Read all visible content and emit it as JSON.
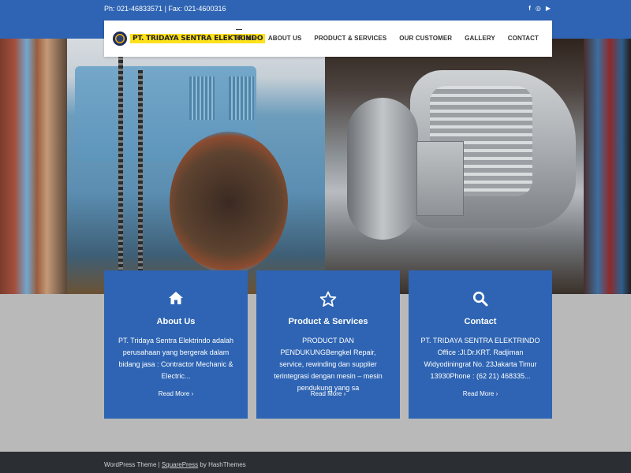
{
  "topbar": {
    "contact_text": "Ph: 021-46833571 | Fax: 021-4600316",
    "social": [
      {
        "icon": "facebook-icon",
        "glyph": "f"
      },
      {
        "icon": "instagram-icon",
        "glyph": "◎"
      },
      {
        "icon": "youtube-icon",
        "glyph": "▶"
      }
    ]
  },
  "brand": {
    "logo_text": "PT. TRIDAYA SENTRA ELEKTRINDO"
  },
  "nav": {
    "items": [
      {
        "label": "HOME",
        "active": true
      },
      {
        "label": "ABOUT US"
      },
      {
        "label": "PRODUCT & SERVICES"
      },
      {
        "label": "OUR CUSTOMER"
      },
      {
        "label": "GALLERY"
      },
      {
        "label": "CONTACT"
      }
    ]
  },
  "cards": [
    {
      "icon": "home-icon",
      "title": "About Us",
      "description": "PT. Tridaya Sentra Elektrindo adalah perusahaan yang bergerak dalam bidang jasa : Contractor Mechanic & Electric...",
      "more": "Read More ›"
    },
    {
      "icon": "star-icon",
      "title": "Product & Services",
      "description": "PRODUCT DAN PENDUKUNGBengkel Repair, service, rewinding dan supplier terintegrasi dengan mesin – mesin pendukung yang sa",
      "more": "Read More ›"
    },
    {
      "icon": "search-icon",
      "title": "Contact",
      "description": "PT. TRIDAYA SENTRA ELEKTRINDO Office :Jl.Dr.KRT. Radjiman Widyodiningrat No. 23Jakarta Timur 13930Phone : (62 21) 468335...",
      "more": "Read More ›"
    }
  ],
  "footer": {
    "prefix": "WordPress Theme | ",
    "link": "SquarePress",
    "suffix": " by HashThemes"
  },
  "colors": {
    "brand_blue": "#2e64b3",
    "footer_dark": "#2b2f33",
    "page_gray": "#b9b9b9",
    "logo_yellow": "#ffe21a"
  }
}
